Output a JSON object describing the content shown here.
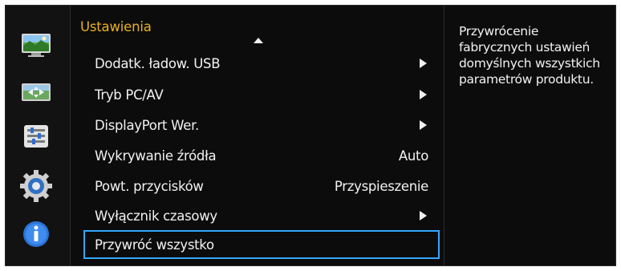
{
  "menu": {
    "title": "Ustawienia",
    "items": [
      {
        "label": "Dodatk. ładow. USB",
        "value": "",
        "has_submenu": true
      },
      {
        "label": "Tryb PC/AV",
        "value": "",
        "has_submenu": true
      },
      {
        "label": "DisplayPort Wer.",
        "value": "",
        "has_submenu": true
      },
      {
        "label": "Wykrywanie źródła",
        "value": "Auto",
        "has_submenu": false
      },
      {
        "label": "Powt. przycisków",
        "value": "Przyspieszenie",
        "has_submenu": false
      },
      {
        "label": "Wyłącznik czasowy",
        "value": "",
        "has_submenu": true
      },
      {
        "label": "Przywróć wszystko",
        "value": "",
        "has_submenu": false,
        "selected": true
      }
    ]
  },
  "description": "Przywrócenie fabrycznych ustawień domyślnych wszystkich parametrów produktu.",
  "sidebar": {
    "icons": [
      "picture-icon",
      "onscreen-display-icon",
      "system-settings-icon",
      "setup-gear-icon",
      "information-icon"
    ]
  },
  "colors": {
    "title": "#e8b020",
    "selection_border": "#33a8ff",
    "background": "#0c0c0c"
  }
}
